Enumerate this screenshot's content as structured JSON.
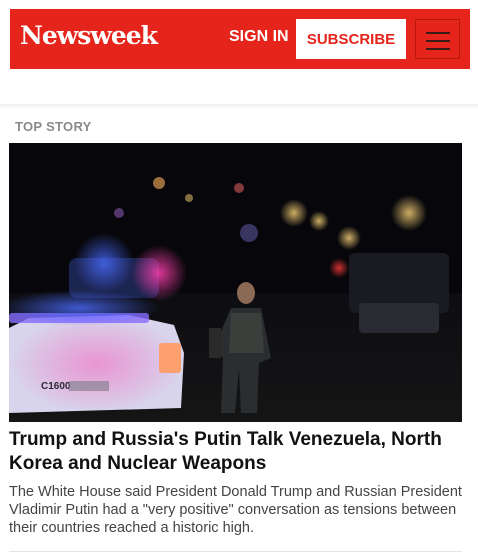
{
  "header": {
    "logo": "Newsweek",
    "sign_in_label": "SIGN IN",
    "subscribe_label": "SUBSCRIBE",
    "menu_icon": "hamburger-menu-icon",
    "brand_color": "#e5241b"
  },
  "top_story": {
    "section_label": "TOP STORY",
    "headline": "Trump and Russia's Putin Talk Venezuela, North Korea and Nuclear Weapons",
    "summary": "The White House said President Donald Trump and Russian President Vladimir Putin had a \"very positive\" conversation as tensions between their countries reached a historic high.",
    "image_text": "C1600"
  }
}
